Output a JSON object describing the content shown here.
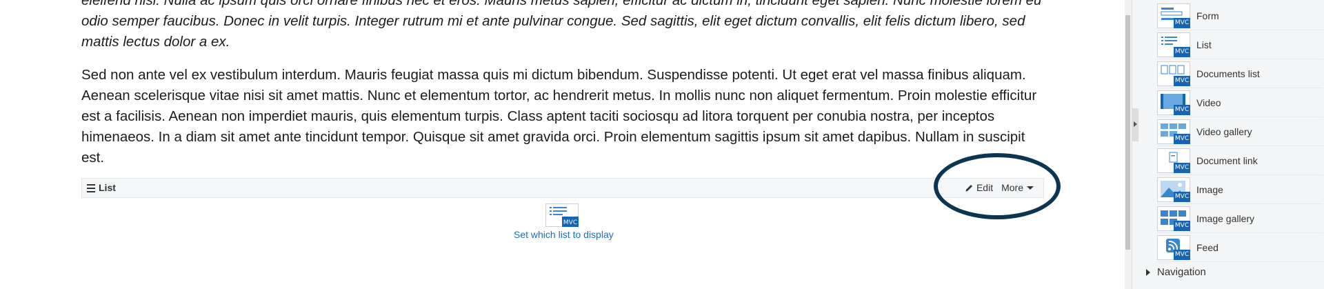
{
  "content": {
    "paragraph_1": "eleifend nisi. Nulla ac ipsum quis orci ornare finibus nec et eros. Mauris metus sapien, efficitur ac dictum in, tincidunt eget sapien. Nunc molestie lorem eu odio semper faucibus. Donec in velit turpis. Integer rutrum mi et ante pulvinar congue. Sed sagittis, elit eget dictum convallis, elit felis dictum libero, sed mattis lectus dolor a ex.",
    "paragraph_2": "Sed non ante vel ex vestibulum interdum. Mauris feugiat massa quis mi dictum bibendum. Suspendisse potenti. Ut eget erat vel massa finibus aliquam. Aenean scelerisque vitae nisi sit amet mattis. Nunc et elementum tortor, ac hendrerit metus. In mollis nunc non aliquet fermentum. Proin molestie efficitur est a facilisis. Aenean non imperdiet mauris, quis elementum turpis. Class aptent taciti sociosqu ad litora torquent per conubia nostra, per inceptos himenaeos. In a diam sit amet ante tincidunt tempor. Quisque sit amet gravida orci. Proin elementum sagittis ipsum sit amet dapibus. Nullam in suscipit est."
  },
  "widget": {
    "title": "List",
    "edit_label": "Edit",
    "more_label": "More",
    "placeholder_badge": "MVC",
    "placeholder_link": "Set which list to display"
  },
  "toolbox": {
    "badge": "MVC",
    "items": [
      {
        "label": "Form",
        "icon": "form-icon"
      },
      {
        "label": "List",
        "icon": "list-icon"
      },
      {
        "label": "Documents list",
        "icon": "documents-list-icon"
      },
      {
        "label": "Video",
        "icon": "video-icon"
      },
      {
        "label": "Video gallery",
        "icon": "video-gallery-icon"
      },
      {
        "label": "Document link",
        "icon": "document-link-icon"
      },
      {
        "label": "Image",
        "icon": "image-icon"
      },
      {
        "label": "Image gallery",
        "icon": "image-gallery-icon"
      },
      {
        "label": "Feed",
        "icon": "feed-icon"
      }
    ],
    "section_label": "Navigation"
  },
  "colors": {
    "accent": "#1565b4",
    "link": "#1a6ec2",
    "highlight_ring": "#0b3553",
    "panel_bg": "#f4f5f6"
  }
}
